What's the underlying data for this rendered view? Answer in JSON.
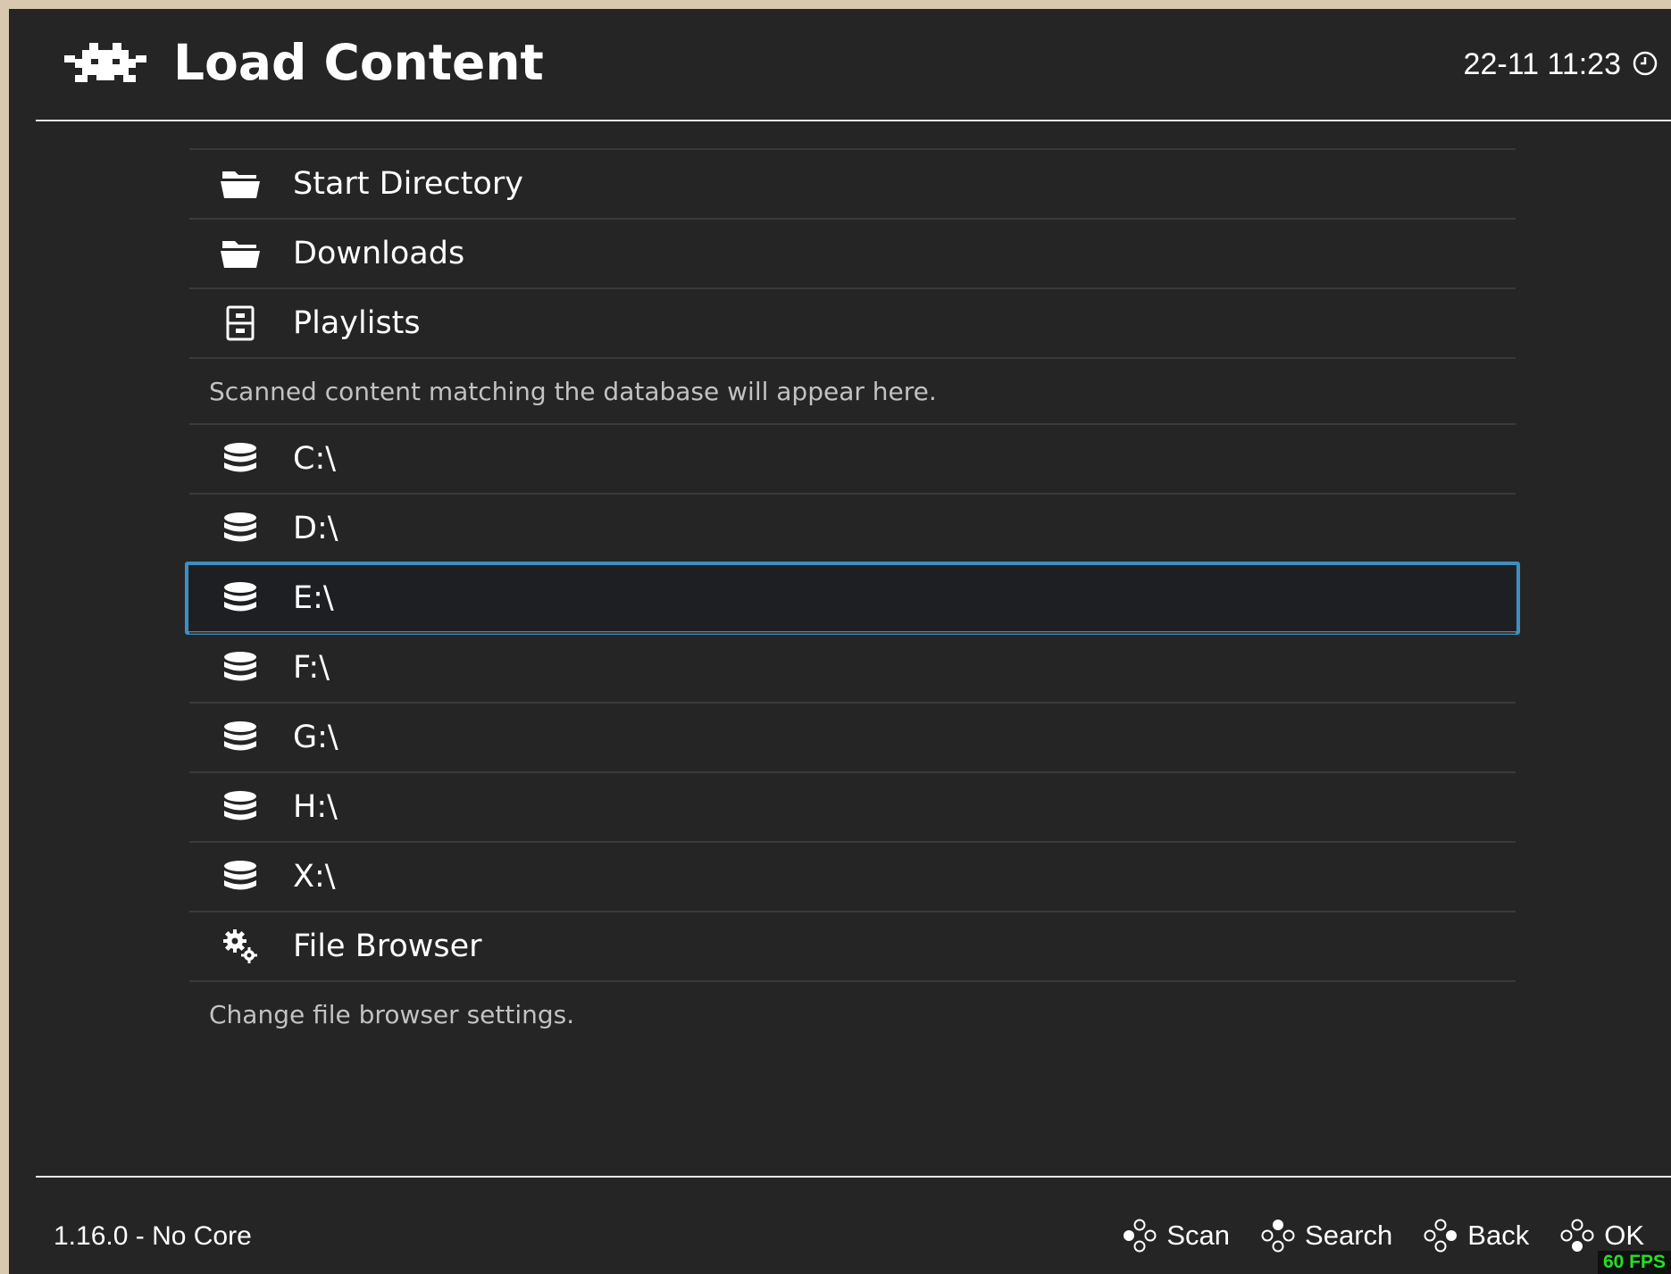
{
  "header": {
    "title": "Load Content",
    "clock": "22-11 11:23",
    "logo_icon": "retroarch-invader-icon",
    "clock_icon": "clock-icon"
  },
  "menu": {
    "items": [
      {
        "label": "Start Directory",
        "icon": "folder-open-icon"
      },
      {
        "label": "Downloads",
        "icon": "folder-open-icon"
      },
      {
        "label": "Playlists",
        "icon": "drawer-icon",
        "sublabel": "Scanned content matching the database will appear here."
      },
      {
        "label": "C:\\",
        "icon": "drive-icon"
      },
      {
        "label": "D:\\",
        "icon": "drive-icon"
      },
      {
        "label": "E:\\",
        "icon": "drive-icon",
        "selected": true
      },
      {
        "label": "F:\\",
        "icon": "drive-icon"
      },
      {
        "label": "G:\\",
        "icon": "drive-icon"
      },
      {
        "label": "H:\\",
        "icon": "drive-icon"
      },
      {
        "label": "X:\\",
        "icon": "drive-icon"
      },
      {
        "label": "File Browser",
        "icon": "gears-icon",
        "sublabel": "Change file browser settings."
      }
    ]
  },
  "footer": {
    "version": "1.16.0 - No Core",
    "hints": [
      {
        "label": "Scan",
        "icon": "gamepad-left-button-icon"
      },
      {
        "label": "Search",
        "icon": "gamepad-top-button-icon"
      },
      {
        "label": "Back",
        "icon": "gamepad-right-button-icon"
      },
      {
        "label": "OK",
        "icon": "gamepad-bottom-button-icon"
      }
    ],
    "fps": "60 FPS"
  },
  "colors": {
    "background": "#252525",
    "selection_border": "#3b8fc4",
    "selection_fill": "#1d1f22",
    "fps": "#23e023"
  }
}
